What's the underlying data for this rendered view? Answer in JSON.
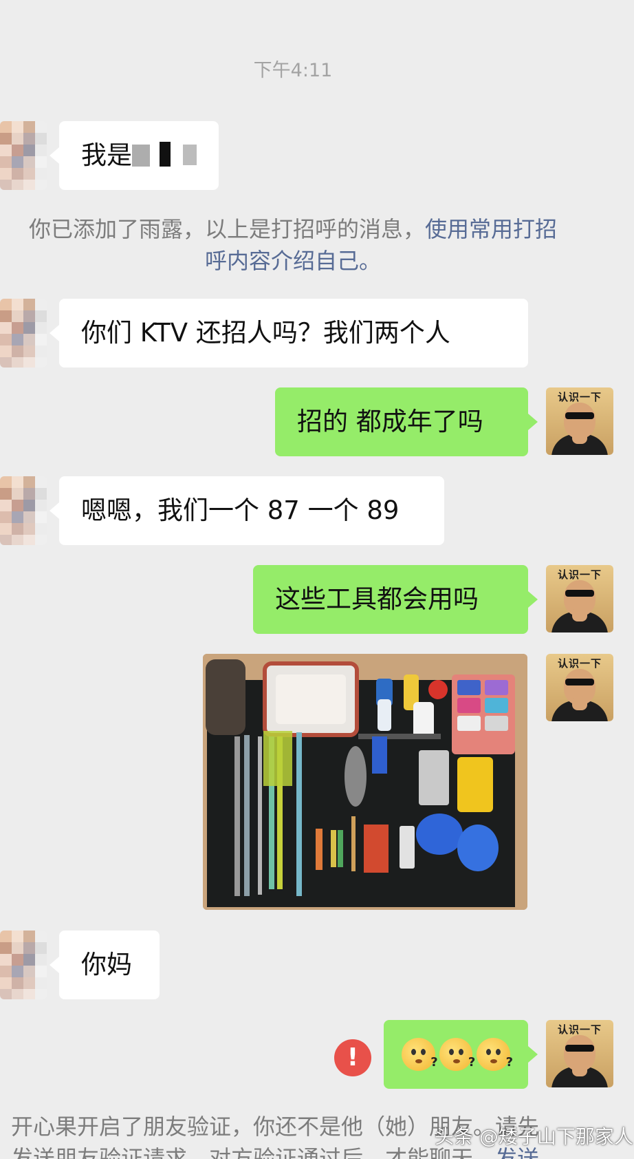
{
  "chat": {
    "timestamp": "下午4:11",
    "messages": [
      {
        "side": "left",
        "text": "我是"
      },
      {
        "side": "left",
        "text": "你们 KTV 还招人吗？我们两个人"
      },
      {
        "side": "right",
        "text": "招的 都成年了吗"
      },
      {
        "side": "left",
        "text": "嗯嗯，我们一个 87 一个 89"
      },
      {
        "side": "right",
        "text": "这些工具都会用吗"
      },
      {
        "side": "left",
        "text": "你妈"
      }
    ],
    "system_note": {
      "text": "你已添加了雨露，以上是打招呼的消息，",
      "link": "使用常用打招",
      "tail": "呼内容介绍自己。"
    },
    "avatar_right_tag": "认识一下",
    "failed_icon": "!",
    "bottom_note": {
      "line1": "开心果开启了朋友验证，你还不是他（她）朋友。请先",
      "line2": "发送朋友验证请求，对方验证通过后，才能聊天。",
      "link": "发送"
    }
  },
  "icons": {
    "failed": "exclamation-icon",
    "emoji": "thinking-face-emoji-icon"
  },
  "watermark": "头条 @矮子山下那家人",
  "colors": {
    "background": "#ededed",
    "bubble_left": "#ffffff",
    "bubble_right": "#95ec69",
    "link": "#576b95",
    "alert": "#e8514a"
  }
}
